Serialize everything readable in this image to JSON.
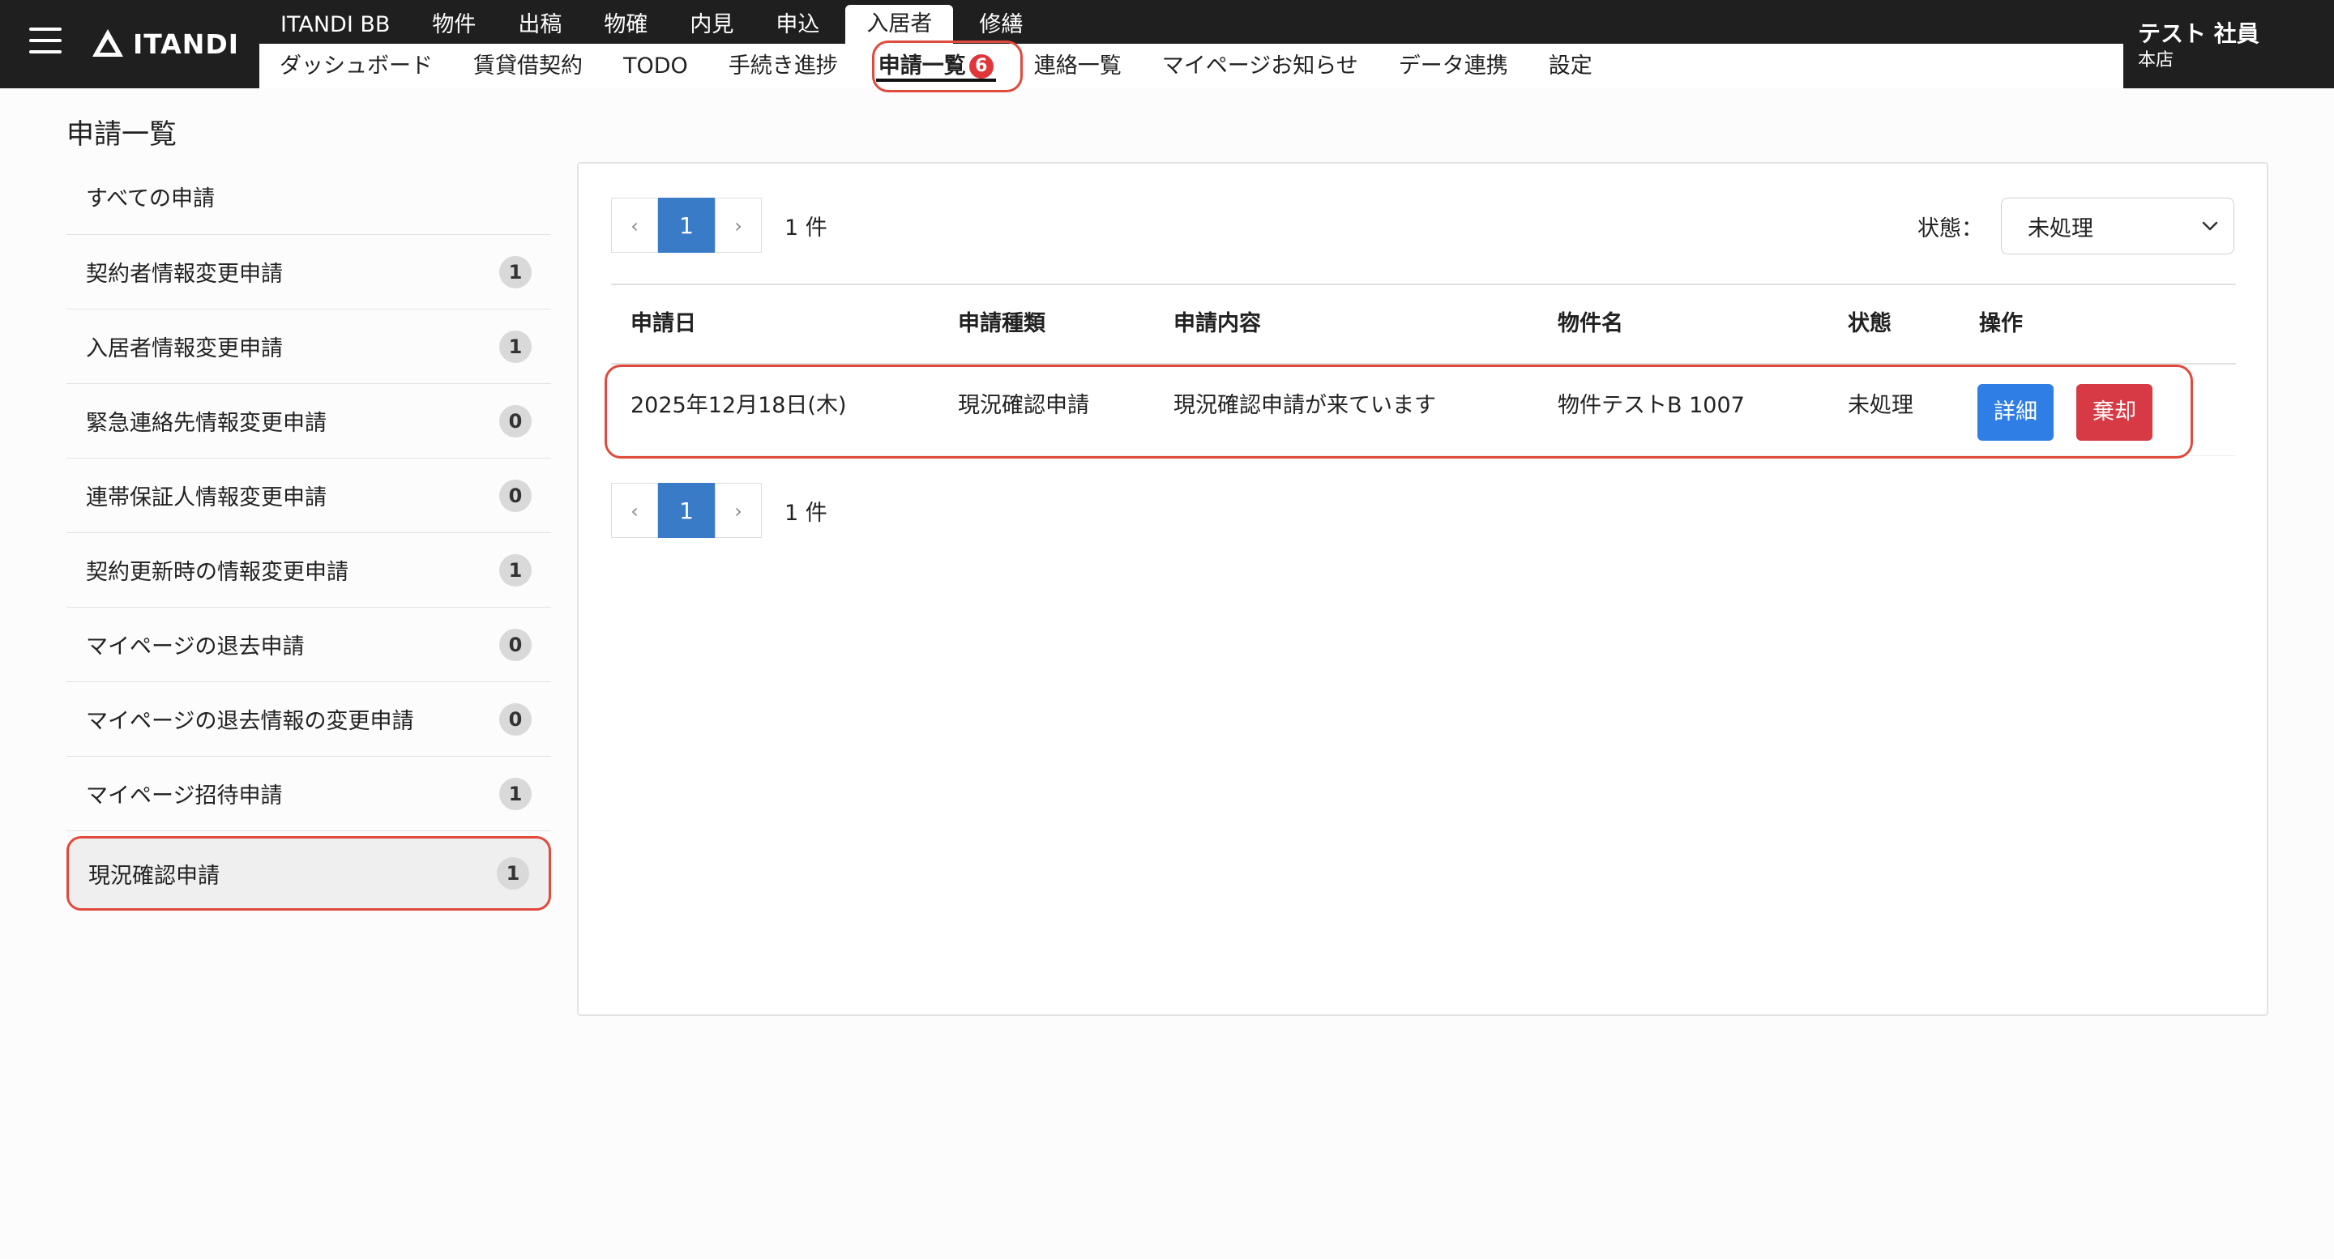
{
  "header": {
    "logo_text": "ITANDI",
    "top_tabs": [
      "ITANDI BB",
      "物件",
      "出稿",
      "物確",
      "内見",
      "申込",
      "入居者",
      "修繕"
    ],
    "active_top_tab": "入居者",
    "sub_tabs": [
      "ダッシュボード",
      "賃貸借契約",
      "TODO",
      "手続き進捗",
      "申請一覧",
      "連絡一覧",
      "マイページお知らせ",
      "データ連携",
      "設定"
    ],
    "active_sub_tab": "申請一覧",
    "active_sub_badge": "6",
    "user_name": "テスト 社員",
    "user_branch": "本店"
  },
  "page": {
    "title": "申請一覧"
  },
  "sidebar": {
    "items": [
      {
        "label": "すべての申請",
        "count": ""
      },
      {
        "label": "契約者情報変更申請",
        "count": "1"
      },
      {
        "label": "入居者情報変更申請",
        "count": "1"
      },
      {
        "label": "緊急連絡先情報変更申請",
        "count": "0"
      },
      {
        "label": "連帯保証人情報変更申請",
        "count": "0"
      },
      {
        "label": "契約更新時の情報変更申請",
        "count": "1"
      },
      {
        "label": "マイページの退去申請",
        "count": "0"
      },
      {
        "label": "マイページの退去情報の変更申請",
        "count": "0"
      },
      {
        "label": "マイページ招待申請",
        "count": "1"
      },
      {
        "label": "現況確認申請",
        "count": "1"
      }
    ],
    "active_index": 9
  },
  "pagination": {
    "prev": "‹",
    "current": "1",
    "next": "›",
    "count_text": "1 件"
  },
  "filter": {
    "label": "状態：",
    "value": "未処理"
  },
  "table": {
    "headers": [
      "申請日",
      "申請種類",
      "申請内容",
      "物件名",
      "状態",
      "操作"
    ],
    "rows": [
      {
        "date": "2025年12月18日(木)",
        "type": "現況確認申請",
        "content": "現況確認申請が来ています",
        "property": "物件テストB 1007",
        "status": "未処理",
        "detail_label": "詳細",
        "discard_label": "棄却"
      }
    ]
  },
  "colors": {
    "header_bg": "#1f1f1f",
    "primary": "#2f7ee6",
    "danger": "#d73a45",
    "pager_active": "#3a7bc8",
    "highlight": "#e04a3c"
  }
}
